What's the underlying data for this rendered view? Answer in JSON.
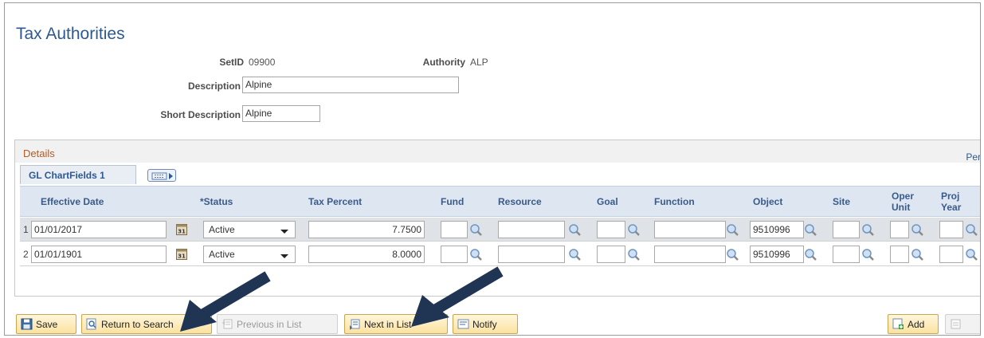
{
  "page": {
    "title": "Tax Authorities"
  },
  "header_fields": {
    "setid_label": "SetID",
    "setid_value": "09900",
    "authority_label": "Authority",
    "authority_value": "ALP",
    "description_label": "Description",
    "description_value": "Alpine",
    "short_description_label": "Short Description",
    "short_description_value": "Alpine"
  },
  "details": {
    "title": "Details",
    "personalize_link": "Per",
    "tab_label": "GL ChartFields 1",
    "columns": {
      "effective_date": "Effective Date",
      "status": "*Status",
      "tax_percent": "Tax Percent",
      "fund": "Fund",
      "resource": "Resource",
      "goal": "Goal",
      "function": "Function",
      "object": "Object",
      "site": "Site",
      "oper_unit_1": "Oper",
      "oper_unit_2": "Unit",
      "proj_year_1": "Proj",
      "proj_year_2": "Year"
    },
    "rows": [
      {
        "num": "1",
        "effective_date": "01/01/2017",
        "status": "Active",
        "tax_percent": "7.7500",
        "object": "9510996"
      },
      {
        "num": "2",
        "effective_date": "01/01/1901",
        "status": "Active",
        "tax_percent": "8.0000",
        "object": "9510996"
      }
    ]
  },
  "toolbar": {
    "save": "Save",
    "return_to_search": "Return to Search",
    "previous_in_list": "Previous in List",
    "next_in_list": "Next in List",
    "notify": "Notify",
    "add": "Add"
  },
  "colors": {
    "title_blue": "#2e5891",
    "details_orange": "#b35a25",
    "header_bg": "#dde6f1",
    "arrow": "#1f3553"
  },
  "icons": [
    "calendar-icon",
    "lookup-icon",
    "save-icon",
    "search-icon",
    "list-icon",
    "notify-icon",
    "add-icon"
  ]
}
